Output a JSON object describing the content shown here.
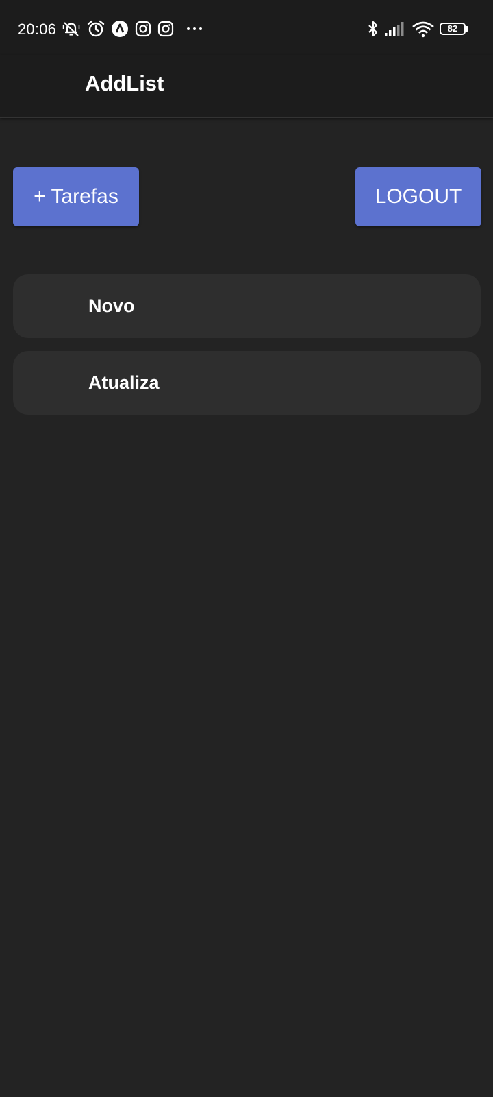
{
  "status_bar": {
    "time": "20:06",
    "battery_level": "82",
    "left_icons": [
      "bell-off-icon",
      "alarm-icon",
      "app-a-icon",
      "instagram-icon",
      "instagram-icon",
      "more-dots-icon"
    ],
    "right_icons": [
      "bluetooth-icon",
      "cell-signal-icon",
      "wifi-icon",
      "battery-icon"
    ]
  },
  "app_bar": {
    "title": "AddList"
  },
  "actions": {
    "add_label": "+ Tarefas",
    "logout_label": "LOGOUT"
  },
  "lists": [
    {
      "label": "Novo"
    },
    {
      "label": "Atualiza"
    }
  ],
  "colors": {
    "background": "#232323",
    "bar": "#1c1c1c",
    "accent": "#5c72cf",
    "card": "#2e2e2e",
    "text": "#ffffff"
  }
}
